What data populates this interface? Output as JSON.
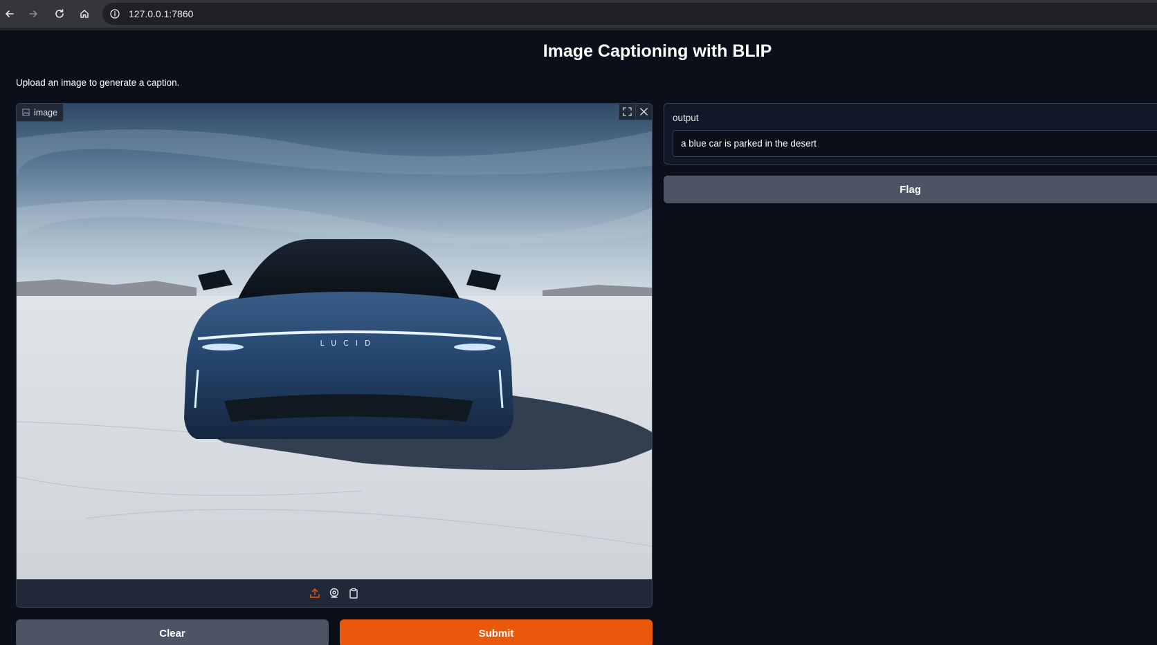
{
  "browser": {
    "url": "127.0.0.1:7860"
  },
  "page": {
    "title": "Image Captioning with BLIP",
    "description": "Upload an image to generate a caption."
  },
  "input": {
    "label": "image",
    "image_alt": "a blue car is parked in the desert"
  },
  "output": {
    "label": "output",
    "value": "a blue car is parked in the desert"
  },
  "buttons": {
    "clear": "Clear",
    "submit": "Submit",
    "flag": "Flag"
  },
  "colors": {
    "background": "#0b0f19",
    "primary": "#ea580c",
    "secondary": "#4b5563",
    "panel": "#1f2937"
  },
  "icons": {
    "back": "arrow-left-icon",
    "forward": "arrow-right-icon",
    "reload": "reload-icon",
    "home": "home-icon",
    "site_info": "info-icon",
    "image_label": "image-icon",
    "fullscreen": "fullscreen-icon",
    "clear_image": "close-icon",
    "upload": "upload-icon",
    "webcam": "webcam-icon",
    "clipboard": "clipboard-icon"
  }
}
